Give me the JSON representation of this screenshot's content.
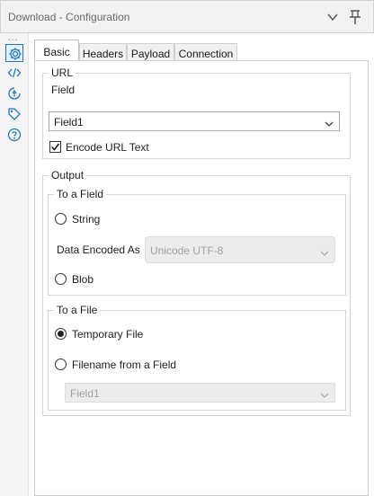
{
  "window": {
    "title": "Download - Configuration",
    "collapse_icon": "chevron-down-icon",
    "pin_icon": "pin-icon"
  },
  "rail": {
    "dots": "...",
    "icons": [
      "gear-icon",
      "code-icon",
      "refresh-icon",
      "tag-icon",
      "help-icon"
    ]
  },
  "tabs": [
    {
      "label": "Basic",
      "active": true
    },
    {
      "label": "Headers",
      "active": false
    },
    {
      "label": "Payload",
      "active": false
    },
    {
      "label": "Connection",
      "active": false
    }
  ],
  "url_section": {
    "legend": "URL",
    "field_label": "Field",
    "field_value": "Field1",
    "encode_label": "Encode URL Text",
    "encode_checked": true
  },
  "output_section": {
    "legend": "Output",
    "to_field": {
      "legend": "To a Field",
      "string_label": "String",
      "string_selected": false,
      "data_encoded_label": "Data Encoded As",
      "data_encoded_value": "Unicode UTF-8",
      "blob_label": "Blob",
      "blob_selected": false
    },
    "to_file": {
      "legend": "To a File",
      "temporary_label": "Temporary File",
      "temporary_selected": true,
      "filename_label": "Filename from a Field",
      "filename_selected": false,
      "filename_field_value": "Field1"
    }
  },
  "colors": {
    "accent": "#1f76c6",
    "titlebar_bg": "#f2f2f2",
    "disabled_bg": "#ececec"
  }
}
